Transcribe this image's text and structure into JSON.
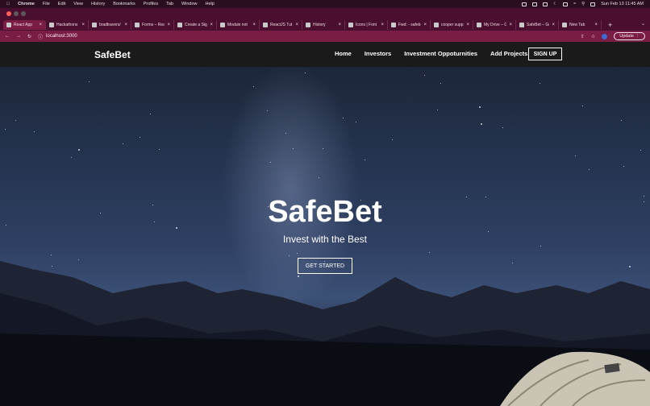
{
  "macos_menu": {
    "apple": "",
    "app": "Chrome",
    "items": [
      "File",
      "Edit",
      "View",
      "History",
      "Bookmarks",
      "Profiles",
      "Tab",
      "Window",
      "Help"
    ],
    "datetime": "Sun Feb 13  11:45 AM"
  },
  "tabs": [
    {
      "label": "React App",
      "active": true
    },
    {
      "label": "Hackathons"
    },
    {
      "label": "bradtravers/"
    },
    {
      "label": "Forms – Rea"
    },
    {
      "label": "Create a Sig"
    },
    {
      "label": "Module not"
    },
    {
      "label": "ReactJS Tut"
    },
    {
      "label": "History"
    },
    {
      "label": "Icons | Font"
    },
    {
      "label": "Fwd: - safeb"
    },
    {
      "label": "cooper supp"
    },
    {
      "label": "My Drive – G"
    },
    {
      "label": "SafeBet – Go"
    },
    {
      "label": "New Tab"
    }
  ],
  "new_tab_symbol": "+",
  "address_bar": {
    "url": "localhost:3000"
  },
  "update_label": "Update",
  "site": {
    "brand": "SafeBet",
    "nav": [
      "Home",
      "Investors",
      "Investment Oppoturnities",
      "Add Projects"
    ],
    "signup": "SIGN UP",
    "hero_title": "SafeBet",
    "hero_subtitle": "Invest with the Best",
    "cta": "GET STARTED"
  },
  "colors": {
    "tab_bar": "#4a0f2e",
    "toolbar": "#7a1d45",
    "navbar": "#1a1a1a"
  }
}
